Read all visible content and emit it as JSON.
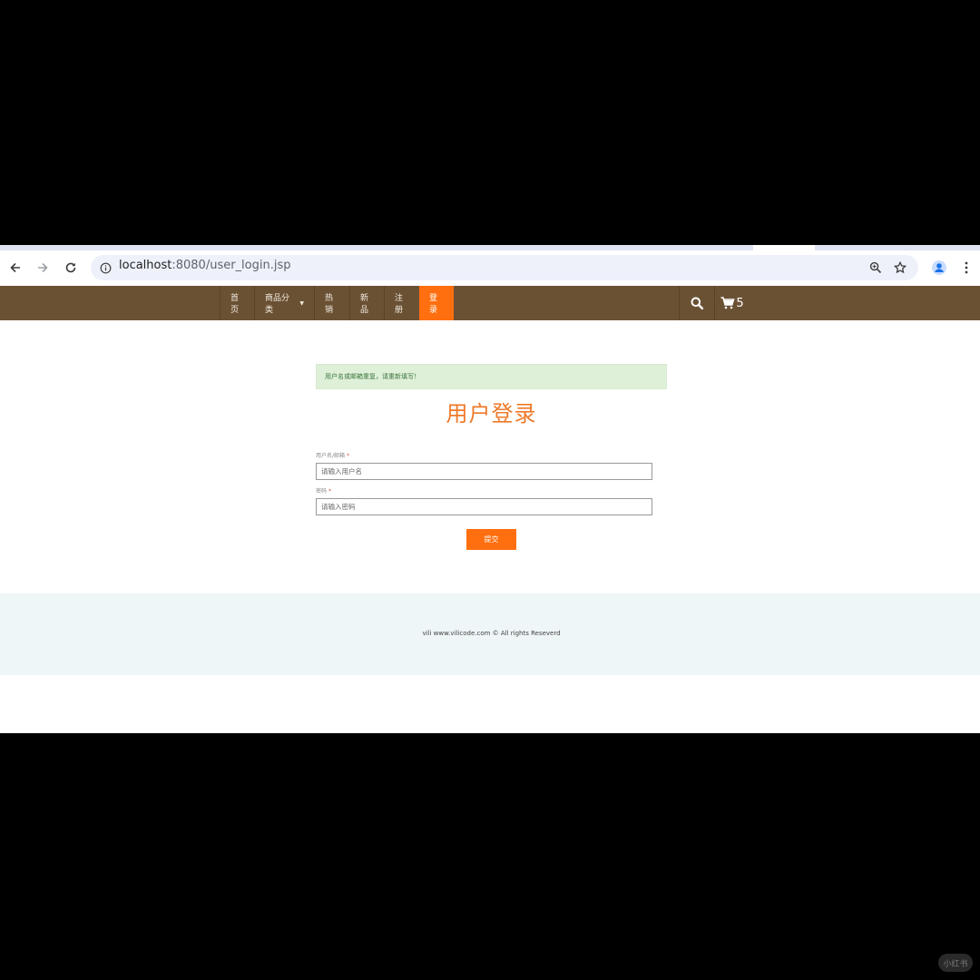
{
  "browser": {
    "url_host": "localhost",
    "url_path": ":8080/user_login.jsp"
  },
  "nav": {
    "items": [
      {
        "label": "首页"
      },
      {
        "label": "商品分类"
      },
      {
        "label": "热销"
      },
      {
        "label": "新品"
      },
      {
        "label": "注册"
      },
      {
        "label": "登录"
      }
    ],
    "active": "登录",
    "cart_count": "5"
  },
  "alert": {
    "message": "用户名或邮箱重复，请重新填写！"
  },
  "form": {
    "title": "用户登录",
    "username_label": "用户名/邮箱",
    "username_placeholder": "请输入用户名",
    "password_label": "密码",
    "password_placeholder": "请输入密码",
    "required_mark": "*",
    "submit_label": "提交"
  },
  "footer": {
    "copyright": "vili www.vilicode.com © All rights Reseverd"
  },
  "watermark": {
    "text": "小红书"
  },
  "colors": {
    "nav_bg": "#6b5134",
    "accent": "#ff6f0f",
    "alert_bg": "#dff0d8",
    "title": "#ee7a2a",
    "footer_bg": "#eef6f7"
  }
}
